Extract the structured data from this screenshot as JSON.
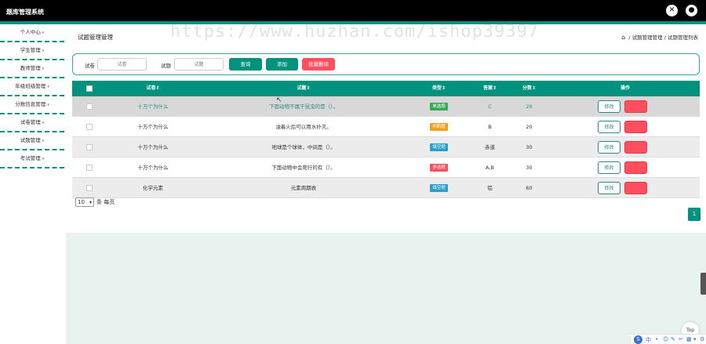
{
  "app": {
    "title": "题库管理系统"
  },
  "colors": {
    "accent": "#00927d",
    "danger": "#ff4f5f",
    "topbar": "#000000"
  },
  "topbar": {
    "close_icon": "close-icon",
    "user_icon": "user-icon"
  },
  "sidebar": {
    "items": [
      {
        "label": "个人中心"
      },
      {
        "label": "学生管理"
      },
      {
        "label": "教师管理"
      },
      {
        "label": "年级班级管理"
      },
      {
        "label": "分数信息管理"
      },
      {
        "label": "试卷管理"
      },
      {
        "label": "试题管理"
      },
      {
        "label": "考试管理"
      }
    ]
  },
  "page": {
    "title": "试题管理管理",
    "breadcrumb": {
      "sep": "/",
      "items": [
        "试题管理管理",
        "试题管理列表"
      ]
    }
  },
  "search": {
    "paper_label": "试卷",
    "paper_placeholder": "试卷",
    "question_label": "试题",
    "question_placeholder": "试题",
    "query_label": "查询",
    "add_label": "添加",
    "batch_delete_label": "批量删除"
  },
  "table": {
    "headers": [
      "试卷",
      "试题",
      "类型",
      "答案",
      "分数",
      "操作"
    ],
    "sort_mark": "⇕",
    "rows": [
      {
        "paper": "十万个为什么",
        "question": "下面动物不属于昆虫的是（）。",
        "type": "单选题",
        "type_color": "#3aa85a",
        "answer": "C",
        "score": "20",
        "edit": "修改",
        "del": "删除"
      },
      {
        "paper": "十万个为什么",
        "question": "油着火后可以用水扑灭。",
        "type": "判断题",
        "type_color": "#f0a020",
        "answer": "B",
        "score": "20",
        "edit": "修改",
        "del": "删除"
      },
      {
        "paper": "十万个为什么",
        "question": "地球是个球体，中间是（）。",
        "type": "填空题",
        "type_color": "#2a9fc8",
        "answer": "赤道",
        "score": "30",
        "edit": "修改",
        "del": "删除"
      },
      {
        "paper": "十万个为什么",
        "question": "下面动物中会爬行的有（）。",
        "type": "多选题",
        "type_color": "#ff4f5f",
        "answer": "A,B",
        "score": "30",
        "edit": "修改",
        "del": "删除"
      },
      {
        "paper": "化学元素",
        "question": "元素周期表",
        "type": "填空题",
        "type_color": "#2a9fc8",
        "answer": "铝",
        "score": "60",
        "edit": "修改",
        "del": "删除"
      }
    ]
  },
  "pager": {
    "page_size": "10",
    "per_page_label": "条 每页",
    "current_page": "1"
  },
  "widgets": {
    "top_label": "Top",
    "logo_glyph": "S",
    "toolbar_first": "中"
  },
  "watermark": "https://www.huzhan.com/ishop39397"
}
